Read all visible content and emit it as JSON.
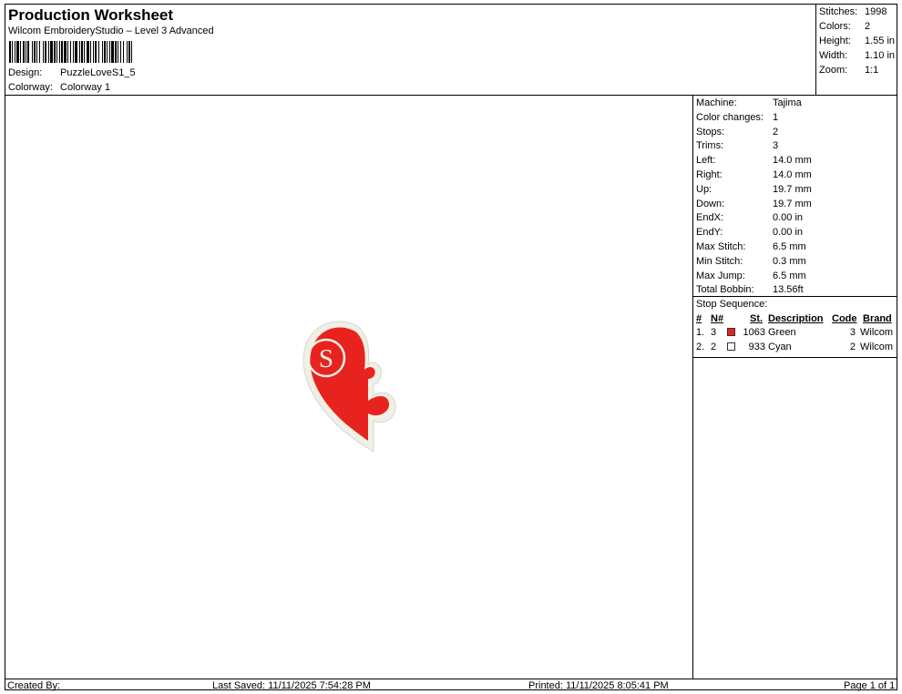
{
  "header": {
    "title": "Production Worksheet",
    "software": "Wilcom EmbroideryStudio – Level 3 Advanced",
    "design_label": "Design:",
    "design_value": "PuzzleLoveS1_5",
    "colorway_label": "Colorway:",
    "colorway_value": "Colorway 1"
  },
  "summary": {
    "stitches_label": "Stitches:",
    "stitches_value": "1998",
    "colors_label": "Colors:",
    "colors_value": "2",
    "height_label": "Height:",
    "height_value": "1.55 in",
    "width_label": "Width:",
    "width_value": "1.10 in",
    "zoom_label": "Zoom:",
    "zoom_value": "1:1"
  },
  "machine_info": [
    {
      "label": "Machine:",
      "value": "Tajima"
    },
    {
      "label": "Color changes:",
      "value": "1"
    },
    {
      "label": "Stops:",
      "value": "2"
    },
    {
      "label": "Trims:",
      "value": "3"
    },
    {
      "label": "Left:",
      "value": "14.0 mm"
    },
    {
      "label": "Right:",
      "value": "14.0 mm"
    },
    {
      "label": "Up:",
      "value": "19.7 mm"
    },
    {
      "label": "Down:",
      "value": "19.7 mm"
    },
    {
      "label": "EndX:",
      "value": "0.00 in"
    },
    {
      "label": "EndY:",
      "value": "0.00 in"
    },
    {
      "label": "Max Stitch:",
      "value": "6.5 mm"
    },
    {
      "label": "Min Stitch:",
      "value": "0.3 mm"
    },
    {
      "label": "Max Jump:",
      "value": "6.5 mm"
    },
    {
      "label": "Total Bobbin:",
      "value": "13.56ft"
    }
  ],
  "stop_sequence": {
    "label": "Stop Sequence:",
    "headers": {
      "num": "#",
      "n": "N#",
      "st": "St.",
      "desc": "Description",
      "code": "Code",
      "brand": "Brand"
    },
    "rows": [
      {
        "num": "1.",
        "n": "3",
        "swatch": "#e8231f",
        "st": "1063",
        "desc": "Green",
        "code": "3",
        "brand": "Wilcom"
      },
      {
        "num": "2.",
        "n": "2",
        "swatch": "#ffffff",
        "st": "933",
        "desc": "Cyan",
        "code": "2",
        "brand": "Wilcom"
      }
    ]
  },
  "design_preview": {
    "letter": "S",
    "fill_color": "#e8231f",
    "border_color": "#f0f0e6"
  },
  "footer": {
    "created_by": "Created By:",
    "last_saved": "Last Saved: 11/11/2025 7:54:28 PM",
    "printed": "Printed: 11/11/2025 8:05:41 PM",
    "page": "Page 1 of 1"
  }
}
